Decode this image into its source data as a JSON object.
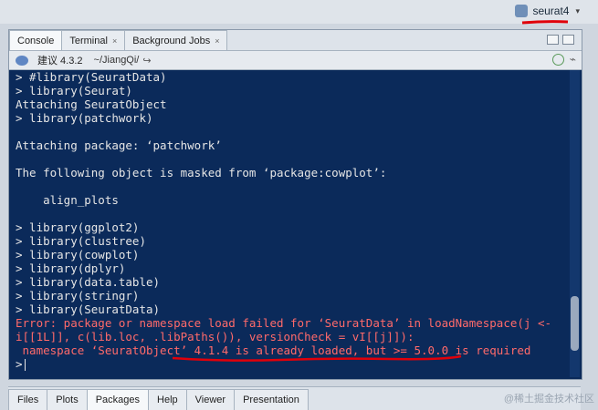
{
  "project": {
    "name": "seurat4"
  },
  "tabs": [
    {
      "label": "Console"
    },
    {
      "label": "Terminal"
    },
    {
      "label": "Background Jobs"
    }
  ],
  "subbar": {
    "r_version": "建议 4.3.2",
    "path": "~/JiangQi/"
  },
  "console": {
    "lines": [
      {
        "text": "> #library(SeuratData)",
        "type": "normal"
      },
      {
        "text": "> library(Seurat)",
        "type": "normal"
      },
      {
        "text": "Attaching SeuratObject",
        "type": "normal"
      },
      {
        "text": "> library(patchwork)",
        "type": "normal"
      },
      {
        "text": "",
        "type": "normal"
      },
      {
        "text": "Attaching package: ‘patchwork’",
        "type": "normal"
      },
      {
        "text": "",
        "type": "normal"
      },
      {
        "text": "The following object is masked from ‘package:cowplot’:",
        "type": "normal"
      },
      {
        "text": "",
        "type": "normal"
      },
      {
        "text": "    align_plots",
        "type": "normal"
      },
      {
        "text": "",
        "type": "normal"
      },
      {
        "text": "> library(ggplot2)",
        "type": "normal"
      },
      {
        "text": "> library(clustree)",
        "type": "normal"
      },
      {
        "text": "> library(cowplot)",
        "type": "normal"
      },
      {
        "text": "> library(dplyr)",
        "type": "normal"
      },
      {
        "text": "> library(data.table)",
        "type": "normal"
      },
      {
        "text": "> library(stringr)",
        "type": "normal"
      },
      {
        "text": "> library(SeuratData)",
        "type": "normal"
      },
      {
        "text": "Error: package or namespace load failed for ‘SeuratData’ in loadNamespace(j <-",
        "type": "error"
      },
      {
        "text": "i[[1L]], c(lib.loc, .libPaths()), versionCheck = vI[[j]]):",
        "type": "error"
      },
      {
        "text": " namespace ‘SeuratObject’ 4.1.4 is already loaded, but >= 5.0.0 is required",
        "type": "error"
      }
    ],
    "prompt": ">"
  },
  "bottom_tabs": [
    {
      "label": "Files"
    },
    {
      "label": "Plots"
    },
    {
      "label": "Packages"
    },
    {
      "label": "Help"
    },
    {
      "label": "Viewer"
    },
    {
      "label": "Presentation"
    }
  ],
  "watermark": "@稀土掘金技术社区",
  "colors": {
    "console_bg": "#0b2a5a",
    "error_text": "#ff6a6a",
    "annotation_red": "#e0000a"
  }
}
